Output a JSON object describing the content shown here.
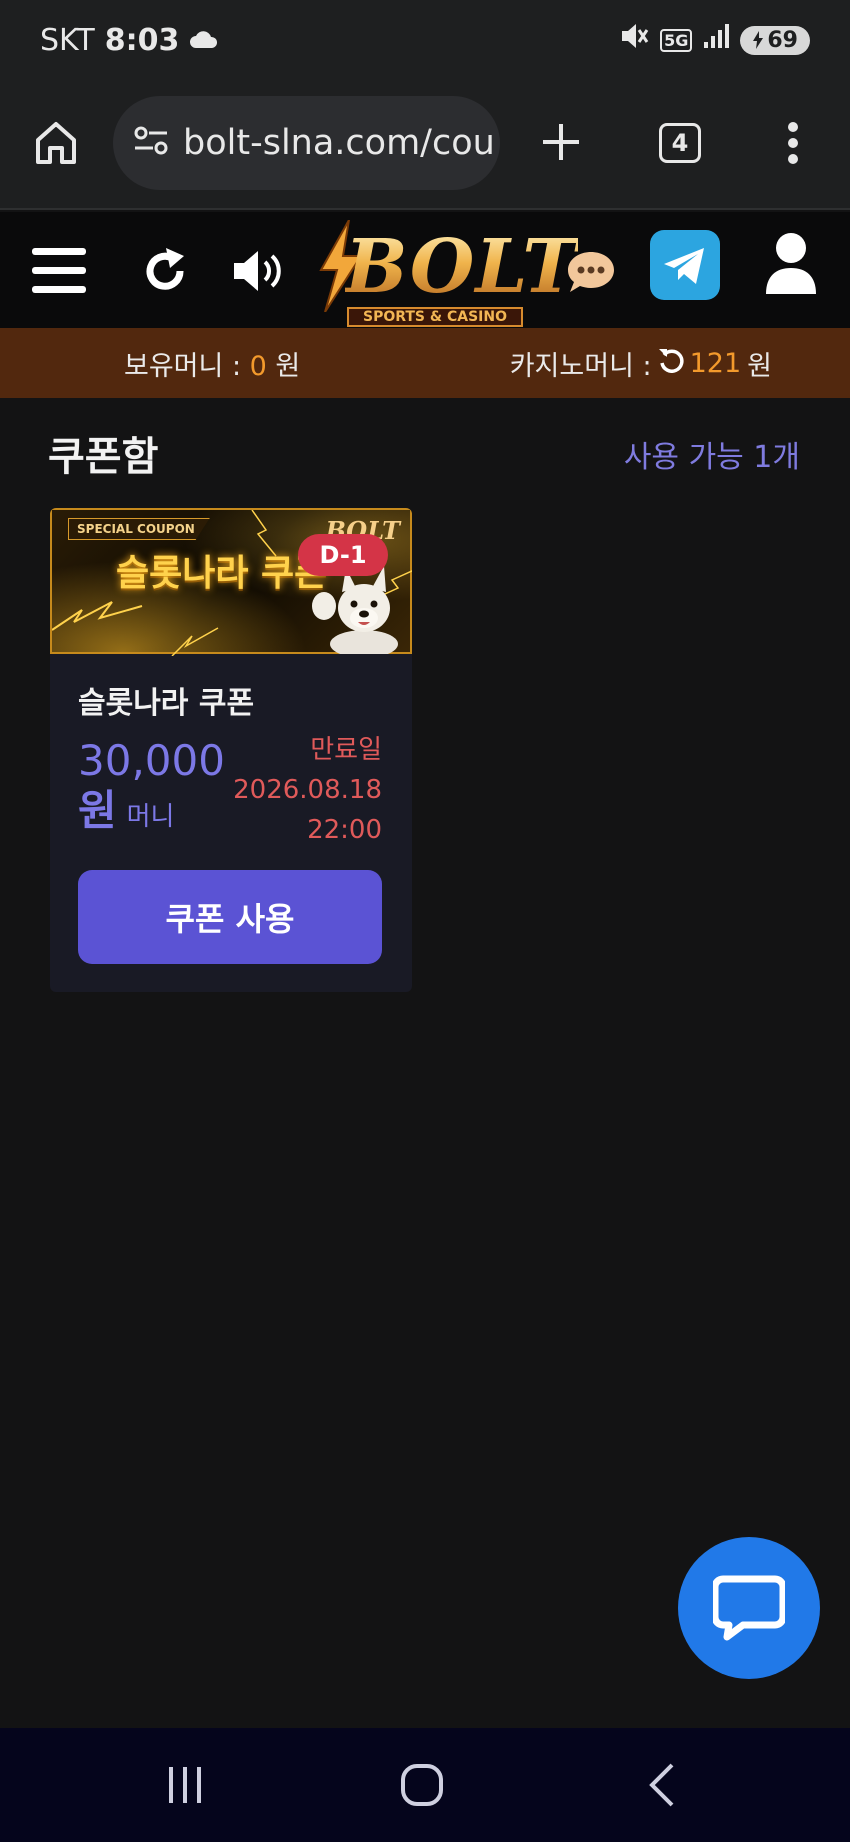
{
  "status_bar": {
    "carrier": "SKT",
    "time": "8:03",
    "network": "5G",
    "battery": "69"
  },
  "browser": {
    "url": "bolt-slna.com/cou",
    "tab_count": "4"
  },
  "site": {
    "logo_text": "BOLT",
    "logo_subtitle": "SPORTS & CASINO"
  },
  "money_bar": {
    "held_label": "보유머니 : ",
    "held_value": "0",
    "held_unit": " 원",
    "casino_label": "카지노머니 : ",
    "casino_value": "121",
    "casino_unit": " 원"
  },
  "coupon_box": {
    "title": "쿠폰함",
    "available": "사용 가능 1개"
  },
  "coupon": {
    "special_tag": "SPECIAL COUPON",
    "banner_title": "슬롯나라 쿠폰",
    "banner_brand": "BOLT",
    "dday": "D-1",
    "name": "슬롯나라 쿠폰",
    "amount": "30,000",
    "amount_unit": "원",
    "money_type": "머니",
    "expiry_label": "만료일",
    "expiry_date": "2026.08.18",
    "expiry_time": "22:00",
    "use_button": "쿠폰 사용"
  },
  "colors": {
    "background": "#131314",
    "money_bar": "#52280e",
    "accent_purple": "#5b53d4",
    "amount_purple": "#7c78e6",
    "expiry_red": "#e05a5a",
    "money_orange": "#f39a2c",
    "dday_red": "#d43447",
    "chat_blue": "#2179e8"
  },
  "icons": {
    "header": [
      "menu-icon",
      "refresh-icon",
      "speaker-icon",
      "chat-bubble-icon",
      "telegram-icon",
      "user-icon"
    ],
    "browser": [
      "home-icon",
      "site-settings-icon",
      "new-tab-icon",
      "tabs-icon",
      "more-icon"
    ],
    "nav": [
      "recents-icon",
      "home-nav-icon",
      "back-icon"
    ]
  }
}
